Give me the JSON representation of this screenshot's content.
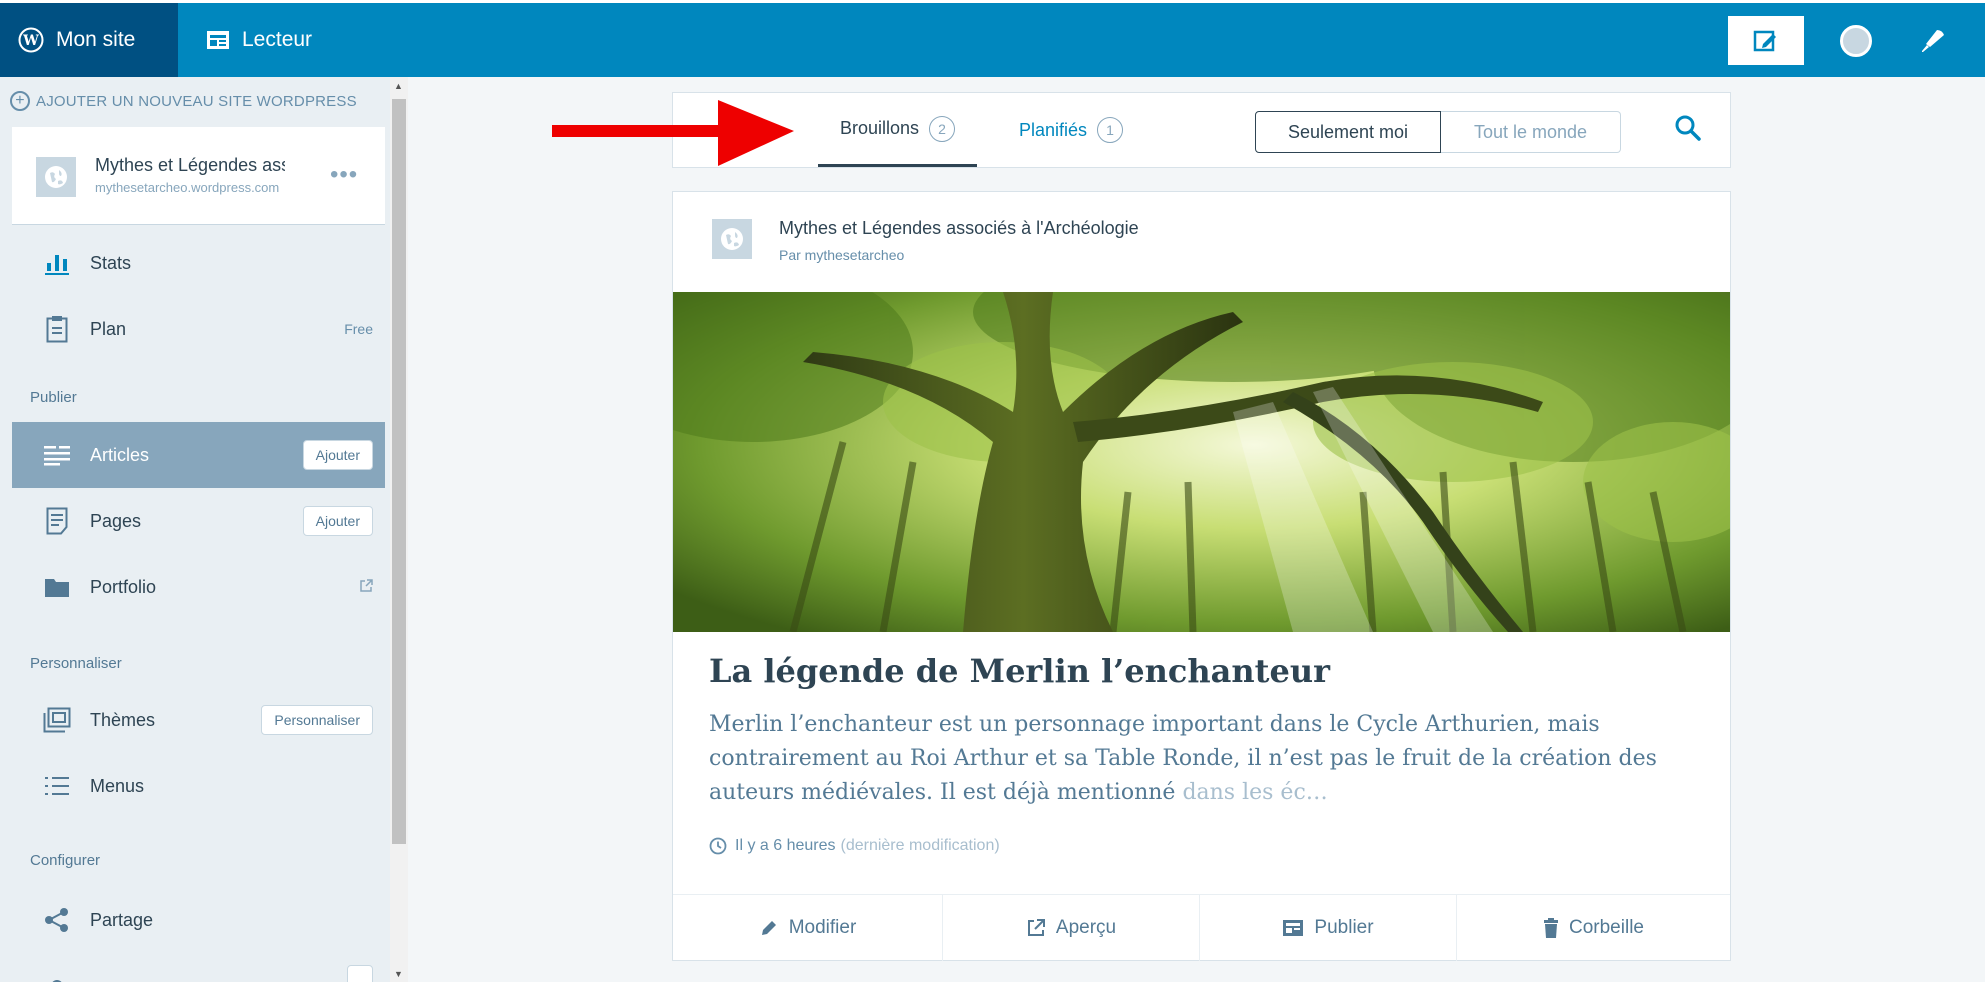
{
  "masterbar": {
    "my_site": "Mon site",
    "reader": "Lecteur"
  },
  "sidebar": {
    "add_site": "AJOUTER UN NOUVEAU SITE WORDPRESS",
    "site": {
      "name": "Mythes et Légendes associés à l'Archéologie",
      "url": "mythesetarcheo.wordpress.com"
    },
    "stats": "Stats",
    "plan": {
      "label": "Plan",
      "badge": "Free"
    },
    "publish_heading": "Publier",
    "articles": {
      "label": "Articles",
      "action": "Ajouter"
    },
    "pages": {
      "label": "Pages",
      "action": "Ajouter"
    },
    "portfolio": "Portfolio",
    "customize_heading": "Personnaliser",
    "themes": {
      "label": "Thèmes",
      "action": "Personnaliser"
    },
    "menus": "Menus",
    "configure_heading": "Configurer",
    "sharing": "Partage"
  },
  "nav": {
    "tabs": [
      {
        "label": "Brouillons",
        "count": "2"
      },
      {
        "label": "Planifiés",
        "count": "1"
      }
    ],
    "scope": {
      "mine": "Seulement moi",
      "everyone": "Tout le monde"
    }
  },
  "post": {
    "site_title": "Mythes et Légendes associés à l'Archéologie",
    "author": "Par mythesetarcheo",
    "title": "La légende de Merlin l’enchanteur",
    "excerpt_main": "Merlin l’enchanteur est un personnage important dans le Cycle Arthurien, mais contrairement au Roi Arthur et sa Table Ronde, il n’est pas le fruit de la création des auteurs médiévales. Il est déjà mentionné ",
    "excerpt_fade": "dans les éc…",
    "time": "Il y a 6 heures",
    "time_note": "(dernière modification)",
    "actions": {
      "edit": "Modifier",
      "preview": "Aperçu",
      "publish": "Publier",
      "trash": "Corbeille"
    }
  },
  "colors": {
    "masterbar": "#0087be",
    "masterbar_active": "#005082",
    "sidebar_active": "#87a6bc",
    "link": "#0087be",
    "arrow": "#ee0000"
  }
}
